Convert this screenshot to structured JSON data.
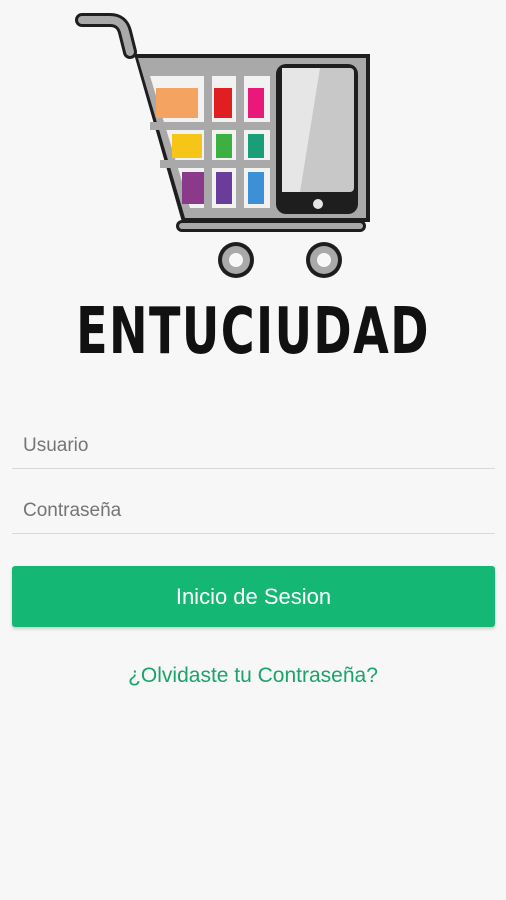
{
  "app": {
    "brand_name": "ENTUCIUDAD",
    "logo_icon": "shopping-cart-with-phone-icon"
  },
  "login_form": {
    "username_placeholder": "Usuario",
    "password_placeholder": "Contraseña",
    "submit_label": "Inicio de Sesion",
    "forgot_password_link": "¿Olvidaste tu Contraseña?"
  },
  "colors": {
    "accent": "#15b774",
    "link": "#1ba36b",
    "background": "#f7f7f7",
    "brand_text": "#111111",
    "cart_body": "#a9a9a9",
    "cart_tiles": [
      "#f4a460",
      "#e02020",
      "#e8197a",
      "#f5c518",
      "#3cb043",
      "#1a9e77",
      "#8b3a8b",
      "#6a3d9a",
      "#3d8fd6"
    ]
  }
}
